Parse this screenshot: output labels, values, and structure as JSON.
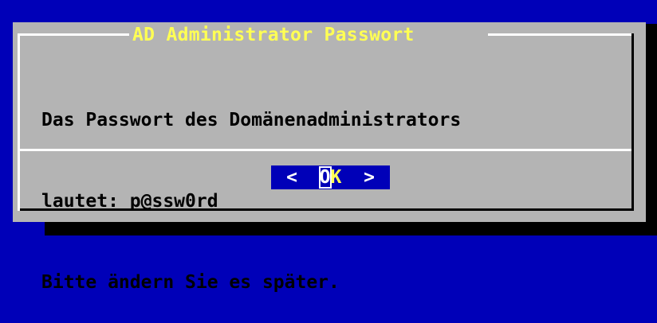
{
  "dialog": {
    "title": "AD Administrator Passwort",
    "message_lines": [
      "Das Passwort des Domänenadministrators",
      "lautet: p@ssw0rd",
      "Bitte ändern Sie es später."
    ],
    "ok_button": {
      "left_bracket": "<",
      "hotkey": "O",
      "rest": "K",
      "right_bracket": ">"
    }
  },
  "colors": {
    "screen_background": "#0000b8",
    "dialog_background": "#b4b4b4",
    "title_text": "#ffff54",
    "button_background": "#0000b8"
  }
}
